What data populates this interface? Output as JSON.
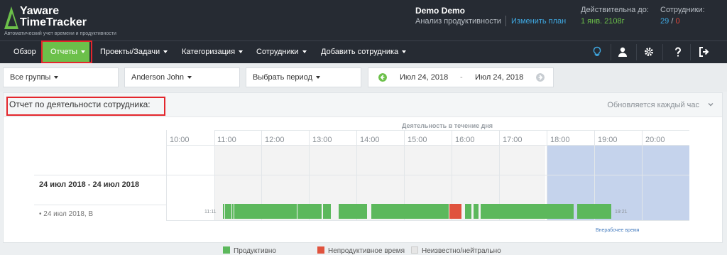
{
  "brand": {
    "name_line1": "Yaware",
    "name_line2": "TimeTracker",
    "tagline": "Автоматический учет времени и продуктивности"
  },
  "account": {
    "name": "Demo Demo",
    "plan": "Анализ продуктивности",
    "change_plan": "Изменить план",
    "valid_label": "Действительна до:",
    "valid_value": "1 янв. 2108г",
    "employees_label": "Сотрудники:",
    "employees_active": "29",
    "employees_sep": "/",
    "employees_other": "0"
  },
  "nav": {
    "items": [
      {
        "label": "Обзор"
      },
      {
        "label": "Отчеты"
      },
      {
        "label": "Проекты/Задачи"
      },
      {
        "label": "Категоризация"
      },
      {
        "label": "Сотрудники"
      },
      {
        "label": "Добавить сотрудника"
      }
    ],
    "icons": [
      "lightbulb-icon",
      "user-icon",
      "gear-icon",
      "question-icon",
      "sign-out-icon"
    ]
  },
  "filters": {
    "group": "Все группы",
    "employee": "Anderson John",
    "period": "Выбрать период",
    "date_from": "Июл 24, 2018",
    "date_dash": "-",
    "date_to": "Июл 24, 2018"
  },
  "report": {
    "title": "Отчет по деятельности сотрудника:",
    "update_note": "Обновляется каждый час",
    "chart_header": "Деятельность в течение дня",
    "range_label": "24 июл 2018 - 24 июл 2018",
    "day_label": "• 24 июл 2018, В",
    "start_time": "11:11",
    "end_time": "19:21",
    "outside_label": "Внерабочее время"
  },
  "chart_data": {
    "type": "timeline",
    "title": "Деятельность в течение дня",
    "hours": [
      "10:00",
      "11:00",
      "12:00",
      "13:00",
      "14:00",
      "15:00",
      "16:00",
      "17:00",
      "18:00",
      "19:00",
      "20:00"
    ],
    "work_hours": [
      "11:00",
      "18:00"
    ],
    "outside_hours": [
      "18:00",
      "21:00"
    ],
    "day": "24 июл 2018, В",
    "start": "11:11",
    "end": "19:21",
    "segments": [
      {
        "start": "11:11",
        "end": "11:12",
        "status": "productive"
      },
      {
        "start": "11:13",
        "end": "11:14",
        "status": "productive"
      },
      {
        "start": "11:15",
        "end": "11:16",
        "status": "productive"
      },
      {
        "start": "11:17",
        "end": "11:18",
        "status": "productive"
      },
      {
        "start": "11:18",
        "end": "11:19",
        "status": "productive"
      },
      {
        "start": "11:20",
        "end": "11:21",
        "status": "productive"
      },
      {
        "start": "11:22",
        "end": "11:24",
        "status": "productive"
      },
      {
        "start": "11:25",
        "end": "12:44",
        "status": "productive"
      },
      {
        "start": "12:45",
        "end": "13:15",
        "status": "productive"
      },
      {
        "start": "13:17",
        "end": "13:27",
        "status": "productive"
      },
      {
        "start": "13:37",
        "end": "14:13",
        "status": "productive"
      },
      {
        "start": "14:18",
        "end": "15:56",
        "status": "productive"
      },
      {
        "start": "15:56",
        "end": "16:12",
        "status": "unproductive"
      },
      {
        "start": "16:16",
        "end": "16:24",
        "status": "productive"
      },
      {
        "start": "16:27",
        "end": "16:33",
        "status": "productive"
      },
      {
        "start": "16:36",
        "end": "18:33",
        "status": "productive"
      },
      {
        "start": "18:38",
        "end": "19:21",
        "status": "productive"
      }
    ],
    "legend": [
      {
        "key": "productive",
        "label": "Продуктивно",
        "color": "#5cb85c"
      },
      {
        "key": "unproductive",
        "label": "Непродуктивное время",
        "color": "#e0533e"
      },
      {
        "key": "neutral",
        "label": "Неизвестно/нейтрально",
        "color": "#e6e6e6"
      }
    ]
  },
  "colors": {
    "topbar": "#262b33",
    "accent_green": "#6cc04a",
    "link_blue": "#3fa9e3",
    "highlight_red": "#e3262c",
    "outside_hours": "#c5d3ec"
  }
}
